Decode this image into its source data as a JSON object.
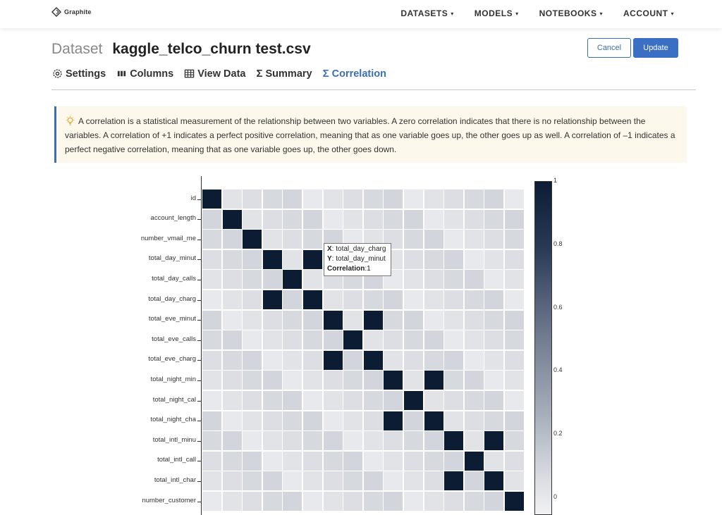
{
  "brand": {
    "name": "Graphite"
  },
  "nav": [
    {
      "label": "DATASETS",
      "caret": "▾"
    },
    {
      "label": "MODELS",
      "caret": "▾"
    },
    {
      "label": "NOTEBOOKS",
      "caret": "▾"
    },
    {
      "label": "ACCOUNT",
      "caret": "▾"
    }
  ],
  "header": {
    "kind": "Dataset",
    "name": "kaggle_telco_churn test.csv"
  },
  "buttons": {
    "cancel": "Cancel",
    "update": "Update"
  },
  "tabs": [
    {
      "label": "Settings",
      "icon": "gear-icon"
    },
    {
      "label": "Columns",
      "icon": "columns-icon"
    },
    {
      "label": "View Data",
      "icon": "table-icon"
    },
    {
      "label": "Summary",
      "icon": "sigma-icon"
    },
    {
      "label": "Correlation",
      "icon": "sigma-icon",
      "active": true
    }
  ],
  "info": {
    "icon": "lightbulb-icon",
    "text": "A correlation is a statistical measurement of the relationship between two variables. A zero correlation indicates that there is no relationship between the variables. A correlation of +1 indicates a perfect positive correlation, meaning that as one variable goes up, the other goes up as well. A correlation of –1 indicates a perfect negative correlation, meaning that as one variable goes up, the other goes down."
  },
  "tooltip": {
    "x_label": "X",
    "x_value": ": total_day_charg",
    "y_label": "Y",
    "y_value": ": total_day_minut",
    "corr_label": "Correlation",
    "corr_value": ":1"
  },
  "chart_data": {
    "type": "heatmap",
    "rows": [
      "id",
      "account_length",
      "number_vmail_me",
      "total_day_minut",
      "total_day_calls",
      "total_day_charg",
      "total_eve_minut",
      "total_eve_calls",
      "total_eve_charg",
      "total_night_min",
      "total_night_cal",
      "total_night_cha",
      "total_intl_minu",
      "total_intl_call",
      "total_intl_char",
      "number_customer"
    ],
    "colorbar": {
      "min": 0,
      "max": 1,
      "ticks": [
        "1",
        "0.8",
        "0.6",
        "0.4",
        "0.2",
        "0"
      ]
    },
    "strong_pairs": [
      [
        3,
        5
      ],
      [
        6,
        8
      ],
      [
        9,
        11
      ],
      [
        12,
        14
      ]
    ],
    "colors": {
      "max": "#0c1c33",
      "min": "#f1f1f3"
    }
  }
}
